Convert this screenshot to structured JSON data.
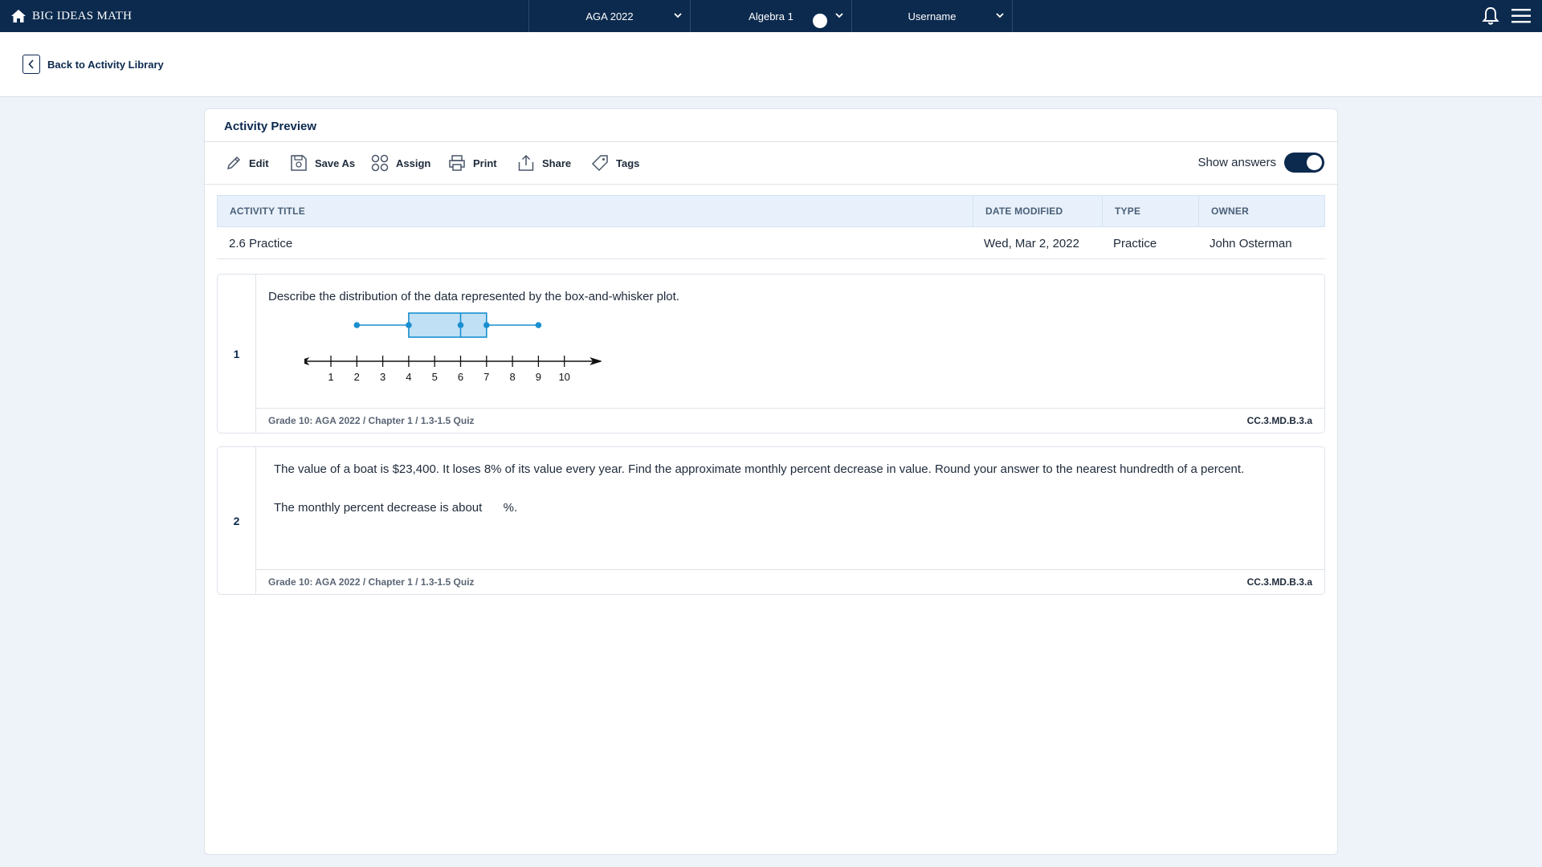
{
  "app": {
    "title": "BIG IDEAS MATH"
  },
  "nav": {
    "program": "AGA 2022",
    "course": "Algebra 1",
    "user": "Username"
  },
  "back": {
    "label": "Back to Activity Library"
  },
  "card": {
    "title": "Activity Preview",
    "toolbar": {
      "edit": "Edit",
      "save_as": "Save As",
      "assign": "Assign",
      "print": "Print",
      "share": "Share",
      "tags": "Tags",
      "show_answers": "Show answers",
      "show_answers_on": true
    },
    "table": {
      "headers": [
        "ACTIVITY TITLE",
        "DATE MODIFIED",
        "TYPE",
        "OWNER"
      ],
      "row": [
        "2.6 Practice",
        "Wed, Mar 2, 2022",
        "Practice",
        "John Osterman"
      ]
    }
  },
  "questions": [
    {
      "number": "1",
      "text": "Describe the distribution of the data represented by the box-and-whisker plot.",
      "plot": {
        "min": 2,
        "q1": 4,
        "median": 6,
        "q3": 7,
        "max": 9,
        "axis_ticks": [
          "1",
          "2",
          "3",
          "4",
          "5",
          "6",
          "7",
          "8",
          "9",
          "10"
        ]
      },
      "source": "Grade 10: AGA 2022 / Chapter 1 / 1.3-1.5 Quiz",
      "standard": "CC.3.MD.B.3.a"
    },
    {
      "number": "2",
      "text": "The value of a boat is $23,400. It loses 8% of its value every year. Find the approximate monthly percent decrease in value. Round your answer to the nearest hundredth of a percent.",
      "answer_prefix": "The monthly percent decrease is about",
      "answer_suffix": "%.",
      "source": "Grade 10: AGA 2022 / Chapter 1 / 1.3-1.5 Quiz",
      "standard": "CC.3.MD.B.3.a"
    }
  ],
  "colors": {
    "nav": "#0c2a4e",
    "accent": "#1a8fd0",
    "box_fill": "#bfe0f5"
  }
}
